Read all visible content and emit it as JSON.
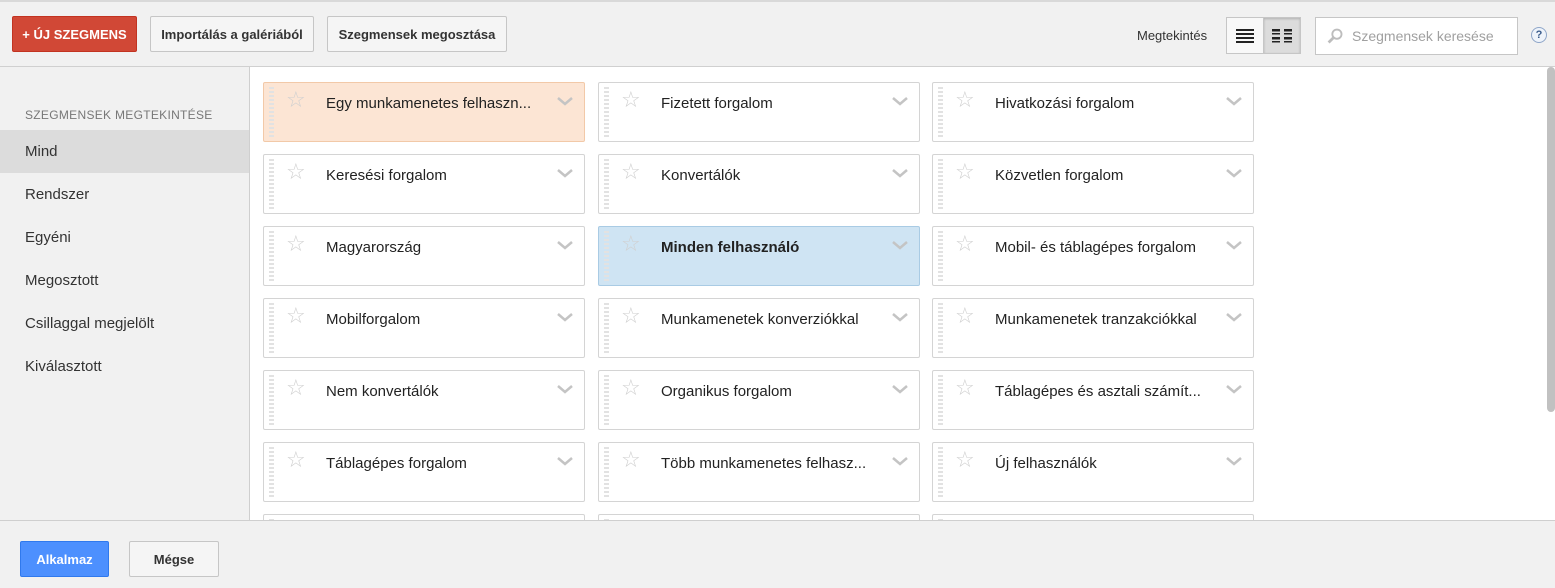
{
  "toolbar": {
    "new_segment_label": "+ ÚJ SZEGMENS",
    "import_label": "Importálás a galériából",
    "share_label": "Szegmensek megosztása",
    "view_label": "Megtekintés",
    "list_view_icon": "list-view-icon",
    "grid_view_icon": "grid-view-icon",
    "active_view": "grid",
    "search_placeholder": "Szegmensek keresése",
    "help_label": "?"
  },
  "sidebar": {
    "heading": "SZEGMENSEK MEGTEKINTÉSE",
    "selected": "Mind",
    "items": [
      {
        "label": "Mind"
      },
      {
        "label": "Rendszer"
      },
      {
        "label": "Egyéni"
      },
      {
        "label": "Megosztott"
      },
      {
        "label": "Csillaggal megjelölt"
      },
      {
        "label": "Kiválasztott"
      }
    ]
  },
  "segments": [
    {
      "label": "Egy munkamenetes felhaszn...",
      "state": "highlight-orange"
    },
    {
      "label": "Fizetett forgalom",
      "state": ""
    },
    {
      "label": "Hivatkozási forgalom",
      "state": ""
    },
    {
      "label": "Keresési forgalom",
      "state": ""
    },
    {
      "label": "Konvertálók",
      "state": ""
    },
    {
      "label": "Közvetlen forgalom",
      "state": ""
    },
    {
      "label": "Magyarország",
      "state": ""
    },
    {
      "label": "Minden felhasználó",
      "state": "highlight-blue"
    },
    {
      "label": "Mobil- és táblagépes forgalom",
      "state": ""
    },
    {
      "label": "Mobilforgalom",
      "state": ""
    },
    {
      "label": "Munkamenetek konverziókkal",
      "state": ""
    },
    {
      "label": "Munkamenetek tranzakciókkal",
      "state": ""
    },
    {
      "label": "Nem konvertálók",
      "state": ""
    },
    {
      "label": "Organikus forgalom",
      "state": ""
    },
    {
      "label": "Táblagépes és asztali számít...",
      "state": ""
    },
    {
      "label": "Táblagépes forgalom",
      "state": ""
    },
    {
      "label": "Több munkamenetes felhasz...",
      "state": ""
    },
    {
      "label": "Új felhasználók",
      "state": ""
    },
    {
      "label": "",
      "state": ""
    },
    {
      "label": "",
      "state": ""
    },
    {
      "label": "",
      "state": ""
    }
  ],
  "footer": {
    "apply_label": "Alkalmaz",
    "cancel_label": "Mégse"
  },
  "colors": {
    "new_button": "#d14836",
    "apply_button": "#4d90fe",
    "orange_highlight": "#fce5d4",
    "blue_highlight": "#cfe4f3"
  }
}
